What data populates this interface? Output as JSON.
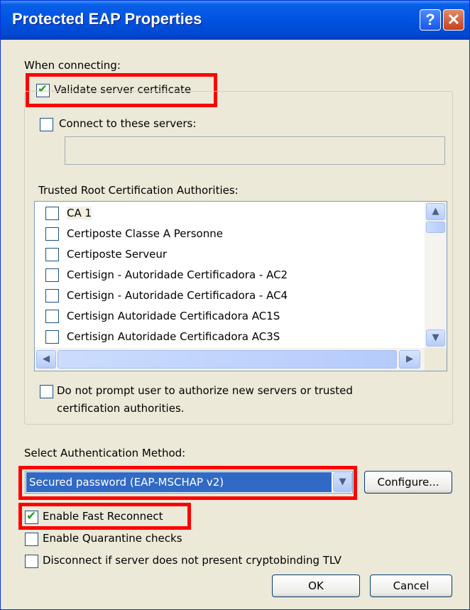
{
  "window": {
    "title": "Protected EAP Properties",
    "help_glyph": "?",
    "close_glyph": "✕"
  },
  "when_connecting_label": "When connecting:",
  "validate_cert": {
    "label": "Validate server certificate",
    "checked": true
  },
  "connect_servers": {
    "label": "Connect to these servers:",
    "checked": false,
    "value": ""
  },
  "trusted_label": "Trusted Root Certification Authorities:",
  "authorities": [
    {
      "name": "CA 1",
      "checked": false
    },
    {
      "name": "Certiposte Classe A Personne",
      "checked": false
    },
    {
      "name": "Certiposte Serveur",
      "checked": false
    },
    {
      "name": "Certisign - Autoridade Certificadora - AC2",
      "checked": false
    },
    {
      "name": "Certisign - Autoridade Certificadora - AC4",
      "checked": false
    },
    {
      "name": "Certisign Autoridade Certificadora AC1S",
      "checked": false
    },
    {
      "name": "Certisign Autoridade Certificadora AC3S",
      "checked": false
    }
  ],
  "no_prompt": {
    "line1": "Do not prompt user to authorize new servers or trusted",
    "line2": "certification authorities.",
    "checked": false
  },
  "auth_method_label": "Select Authentication Method:",
  "auth_method_value": "Secured password (EAP-MSCHAP v2)",
  "configure_label": "Configure...",
  "fast_reconnect": {
    "label": "Enable Fast Reconnect",
    "checked": true
  },
  "quarantine": {
    "label": "Enable Quarantine checks",
    "checked": false
  },
  "cryptobinding": {
    "label": "Disconnect if server does not present cryptobinding TLV",
    "checked": false
  },
  "ok_label": "OK",
  "cancel_label": "Cancel",
  "icons": {
    "checkmark": "✔",
    "scroll_up": "▲",
    "scroll_down": "▼",
    "scroll_left": "◀",
    "scroll_right": "▶",
    "dropdown": "▼"
  },
  "colors": {
    "highlight_box": "#ff0000",
    "selection": "#316ac5",
    "titlebar": "#0054e3"
  }
}
